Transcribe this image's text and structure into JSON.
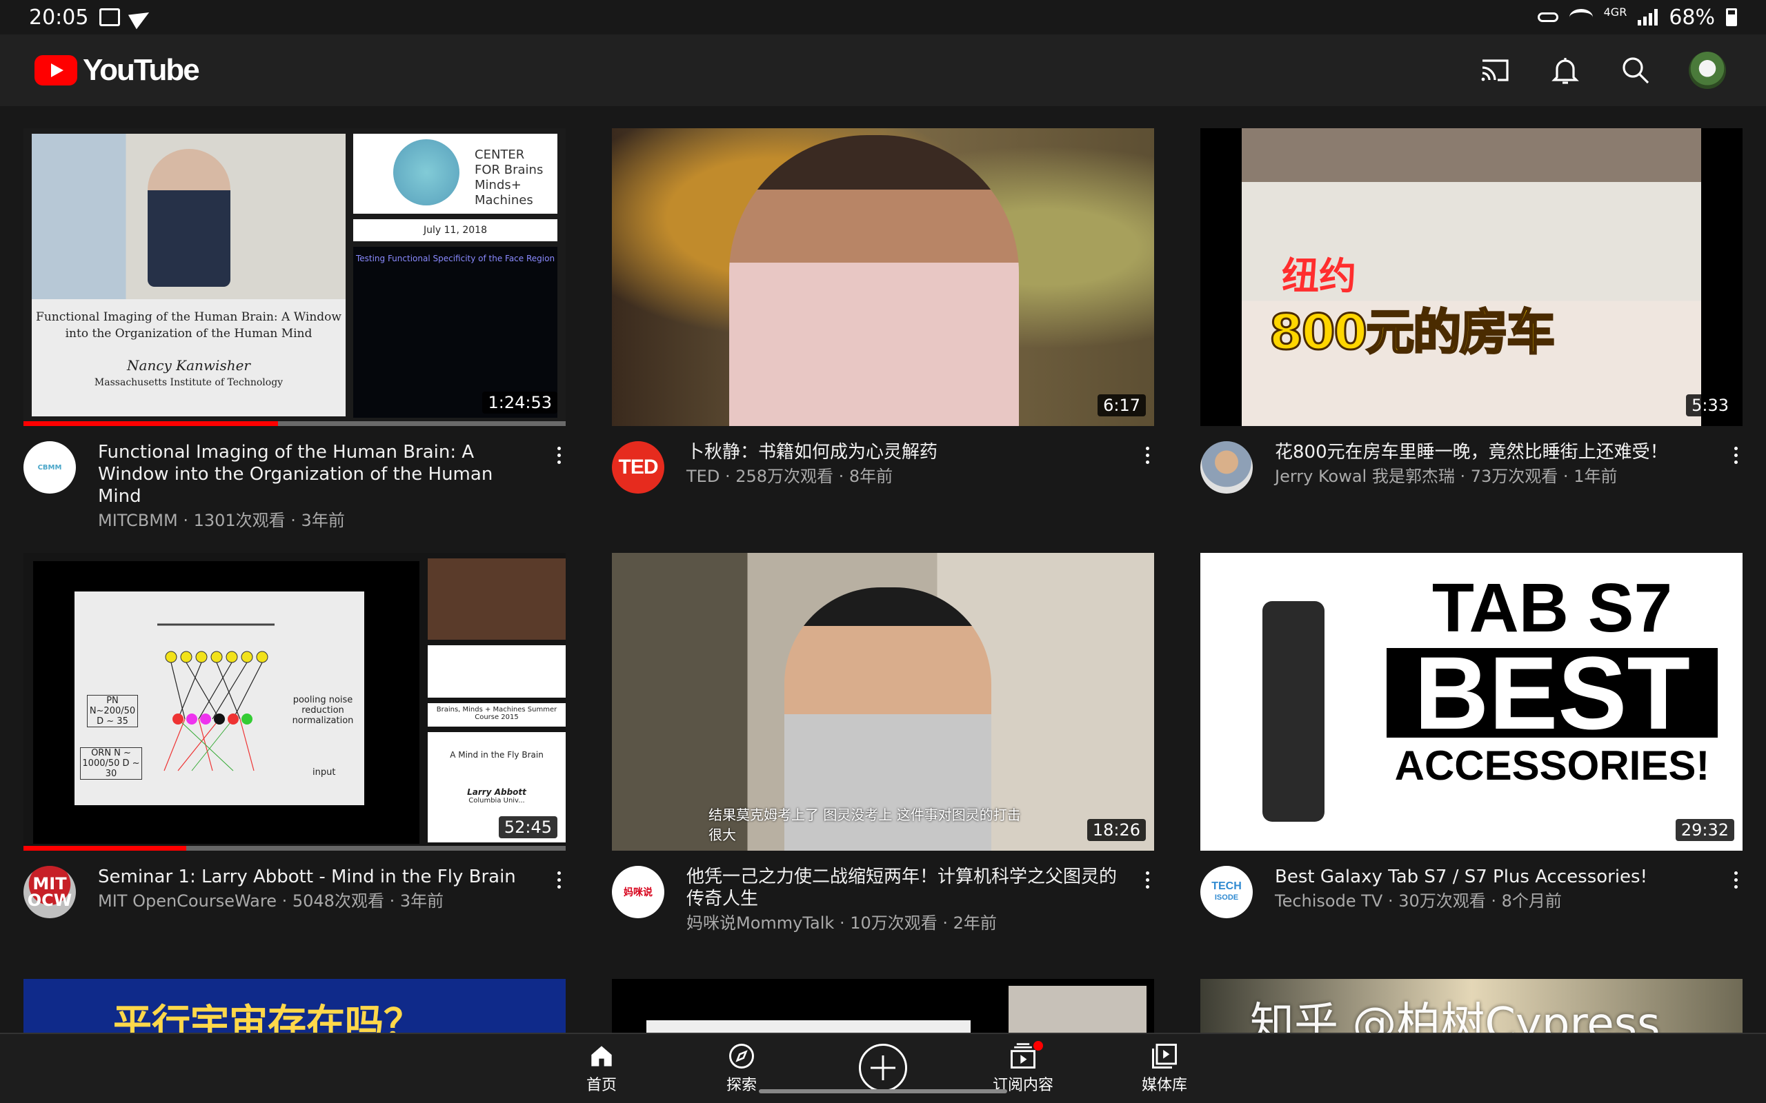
{
  "status_bar": {
    "time": "20:05",
    "network": "4GR",
    "battery": "68%"
  },
  "app_bar": {
    "logo_text": "YouTube"
  },
  "videos": [
    {
      "title": "Functional Imaging of the Human Brain: A Window into the Organization of the Human Mind",
      "channel": "MITCBMM",
      "views": "1301次观看",
      "age": "3年前",
      "duration": "1:24:53",
      "watched_fraction": 0.47,
      "avatar_text": "CBMM",
      "thumb": {
        "lecture_title": "Functional Imaging of the Human Brain: A Window into the Organization of the Human Mind",
        "speaker": "Nancy Kanwisher",
        "affiliation": "Massachusetts Institute of Technology",
        "center_label": "CENTER FOR Brains Minds+ Machines",
        "date": "July 11, 2018",
        "slide_title": "Testing Functional Specificity of the Face Region"
      }
    },
    {
      "title": "卜秋静：书籍如何成为心灵解药",
      "channel": "TED",
      "views": "258万次观看",
      "age": "8年前",
      "duration": "6:17",
      "avatar_text": "TED"
    },
    {
      "title": "花800元在房车里睡一晚，竟然比睡街上还难受！",
      "channel": "Jerry Kowal 我是郭杰瑞",
      "views": "73万次观看",
      "age": "1年前",
      "duration": "5:33",
      "thumb": {
        "caption_1": "纽约",
        "caption_2": "800元的房车"
      }
    },
    {
      "title": "Seminar 1: Larry Abbott - Mind in the Fly Brain",
      "channel": "MIT OpenCourseWare",
      "views": "5048次观看",
      "age": "3年前",
      "duration": "52:45",
      "watched_fraction": 0.3,
      "avatar_text_1": "MIT",
      "avatar_text_2": "OCW",
      "thumb": {
        "pn": "PN N~200/50 D ~ 35",
        "orn": "ORN N ~ 1000/50 D ~ 30",
        "labels": "pooling noise reduction normalization",
        "input": "input",
        "course": "Brains, Minds + Machines Summer Course 2015",
        "lecture": "A Mind in the Fly Brain",
        "speaker": "Larry Abbott",
        "affiliation": "Columbia Univ..."
      }
    },
    {
      "title": "他凭一己之力使二战缩短两年！计算机科学之父图灵的传奇人生",
      "channel": "妈咪说MommyTalk",
      "views": "10万次观看",
      "age": "2年前",
      "duration": "18:26",
      "avatar_text": "妈咪说",
      "thumb": {
        "subtitle": "结果莫克姆考上了 图灵没考上 这件事对图灵的打击很大"
      }
    },
    {
      "title": "Best Galaxy Tab S7 / S7 Plus Accessories!",
      "channel": "Techisode TV",
      "views": "30万次观看",
      "age": "8个月前",
      "duration": "29:32",
      "avatar_text_1": "TECH",
      "avatar_text_2": "ISODE",
      "thumb": {
        "line1": "TAB S7",
        "line2": "BEST",
        "line3": "ACCESSORIES!"
      }
    },
    {
      "thumb": {
        "caption": "平行宇宙存在吗？"
      }
    }
  ],
  "bottom_nav": {
    "home": "首页",
    "explore": "探索",
    "subscriptions": "订阅内容",
    "library": "媒体库"
  },
  "watermark": "知乎 @柏树Cypress"
}
